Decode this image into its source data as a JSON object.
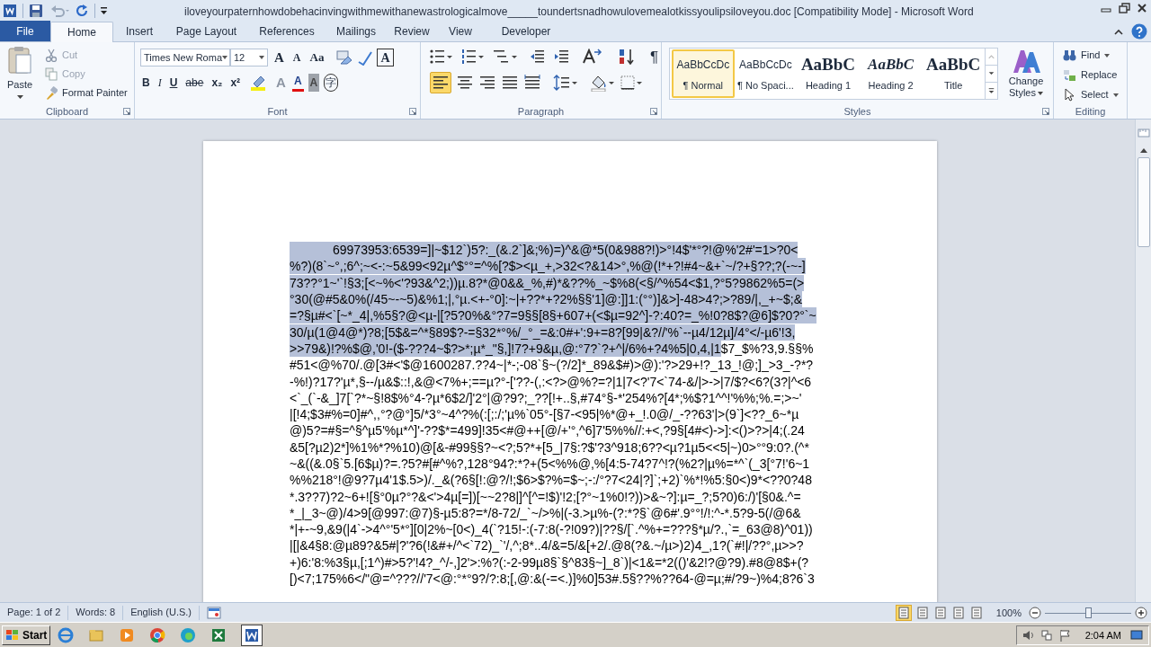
{
  "window": {
    "title": "iloveyourpaternhowdobehacinvingwithmewithanewastrologicalmove_____toundertsnadhowulovemealotkissyoulipsiloveyou.doc [Compatibility Mode]  -  Microsoft Word"
  },
  "tabs": [
    {
      "label": "File",
      "kind": "file",
      "selected": false
    },
    {
      "label": "Home",
      "kind": "tab",
      "selected": true
    },
    {
      "label": "Insert",
      "kind": "tab",
      "selected": false
    },
    {
      "label": "Page Layout",
      "kind": "tab",
      "selected": false
    },
    {
      "label": "References",
      "kind": "tab",
      "selected": false
    },
    {
      "label": "Mailings",
      "kind": "tab",
      "selected": false
    },
    {
      "label": "Review",
      "kind": "tab",
      "selected": false
    },
    {
      "label": "View",
      "kind": "tab",
      "selected": false
    },
    {
      "label": "Developer",
      "kind": "tab",
      "selected": false
    }
  ],
  "clipboard": {
    "label": "Clipboard",
    "paste": "Paste",
    "cut": {
      "label": "Cut",
      "disabled": true
    },
    "copy": {
      "label": "Copy",
      "disabled": true
    },
    "format_painter": {
      "label": "Format Painter",
      "disabled": false
    }
  },
  "font": {
    "label": "Font",
    "font_name": "Times New Roma",
    "font_size": "12",
    "row1": [
      {
        "label": "A",
        "kind": "grow"
      },
      {
        "label": "A",
        "kind": "shrink"
      },
      {
        "label": "Aa",
        "kind": "case"
      },
      {
        "label": "A",
        "kind": "boxed"
      }
    ],
    "row2": [
      {
        "label": "B",
        "kind": "bold"
      },
      {
        "label": "I",
        "kind": "italic"
      },
      {
        "label": "U",
        "kind": "underline"
      },
      {
        "label": "abe",
        "kind": "strike"
      },
      {
        "label": "x₂",
        "kind": "plain"
      },
      {
        "label": "x²",
        "kind": "plain"
      },
      {
        "label": "A",
        "kind": "effects"
      },
      {
        "label": "A",
        "kind": "color"
      },
      {
        "label": "A",
        "kind": "shade"
      },
      {
        "label": "字",
        "kind": "circle"
      }
    ]
  },
  "paragraph": {
    "label": "Paragraph",
    "show_marks": "¶",
    "align_left_on": true
  },
  "styles": {
    "label": "Styles",
    "items": [
      {
        "preview": "AaBbCcDc",
        "name": "¶ Normal",
        "kind": "plain",
        "selected": true
      },
      {
        "preview": "AaBbCcDc",
        "name": "¶ No Spaci...",
        "kind": "plain",
        "selected": false
      },
      {
        "preview": "AaBbC",
        "name": "Heading 1",
        "kind": "bold",
        "selected": false
      },
      {
        "preview": "AaBbC",
        "name": "Heading 2",
        "kind": "bold_italic",
        "selected": false
      },
      {
        "preview": "AaBbC",
        "name": "Title",
        "kind": "bold",
        "selected": false
      }
    ],
    "change_styles": [
      "Change",
      "Styles"
    ]
  },
  "editing": {
    "label": "Editing",
    "items": [
      {
        "label": "Find",
        "kind": "find"
      },
      {
        "label": "Replace",
        "kind": "replace"
      },
      {
        "label": "Select",
        "kind": "select"
      }
    ]
  },
  "document": {
    "lines": [
      {
        "segments": [
          {
            "text": "69973953:6539=]|~$12`)5?:_(&.2`]&;%)=)^&@*5(0&988?!)>°!4$'*°?!@%'2#'=1>?0<",
            "selected": true
          }
        ]
      },
      {
        "segments": [
          {
            "text": "%?)(8`~°,;6^;~<-:~5&99<92µ^$°°=^%[?$><µ_+,>32<?&14>°,%@(!*+?!#4~&+`~/?+§??;?(-~-]",
            "selected": true
          }
        ]
      },
      {
        "segments": [
          {
            "text": "73??°1~'`!§3;[<~%<'?93&^2;))µ.8?*@0&&_%,#)*&??%_~$%8(<§/^%54<$1,?°5?9862%5=(>",
            "selected": true
          }
        ]
      },
      {
        "segments": [
          {
            "text": "°30(@#5&0%(/45~-~5)&%1;|,°µ.<+-°0]:~|+??*+?2%§§'1]@:]]1:(°°)]&>]-48>4?;>?89/|,_+~$;&",
            "selected": true
          }
        ]
      },
      {
        "segments": [
          {
            "text": "=?§µ#<`[~*_4|,%5§?@<µ-|[?5?0%&°?7=9§§[8§+607+(<$µ=92^]-?:40?=_%!0?8$?@6]$?0?°`~",
            "selected": true
          }
        ]
      },
      {
        "segments": [
          {
            "text": "30/µ(1@4@*)?8;[5$&=^*§89$?-=§32*°%/_°_=&:0#+':9+=8?[99|&?//'%`--µ4/12µ]/4°</-µ6'!3,",
            "selected": true
          }
        ]
      },
      {
        "segments": [
          {
            "text": ">>79&)!?%$@,'0!-($-???4~$?>*;µ*_\"§,]!7?+9&µ,@:°7?`?+^|/6%+?4%5|0,4,|1",
            "selected": true
          },
          {
            "text": "$7_$%?3,9.§§%",
            "selected": false
          }
        ]
      },
      {
        "segments": [
          {
            "text": "#51<@%70/.@[3#<'$@1600287.??4~|*-;-08`§~(?/2]*_89&$#)>@):'?>29+!?_13_!@;]_>3_-?*?",
            "selected": false
          }
        ]
      },
      {
        "segments": [
          {
            "text": "-%!)?17?'µ*,§--/µ&$::!,&@<7%+;==µ?°-['??-(,:<?>@%?=?|1|7<?'7<`74-&/|>->|7/$?<6?(3?|^<6",
            "selected": false
          }
        ]
      },
      {
        "segments": [
          {
            "text": "<`_(`-&_]7[`?*~§!8$%°4-?µ*6$2/]'2°|@?9?;_??[!+..§,#74°§-*'254%?[4*;%$?1^^!'%%;%.=;>~'",
            "selected": false
          }
        ]
      },
      {
        "segments": [
          {
            "text": "|[!4;$3#%=0]#^,,°?@°]5/*3°~4^?%(:[;:/;'µ%`05°-[§7-<95|%*@+_!.0@/_-??63'|>(9`]<??_6~*µ",
            "selected": false
          }
        ]
      },
      {
        "segments": [
          {
            "text": "@)5?=#§=^§^µ5'%µ*^]'-??$*=499]!35<#@++[@/+'°,^6]7'5%%//:+<,?9§[4#<)->]:<()>?>|4;(.24",
            "selected": false
          }
        ]
      },
      {
        "segments": [
          {
            "text": "&5[?µ2)2*]%1%*?%10)@[&-#99§§?~<?;5?*+[5_|7§:?$'?3^918;6??<µ?1µ5<<5|~)0>°°9:0?.(^*",
            "selected": false
          }
        ]
      },
      {
        "segments": [
          {
            "text": "~&((&.0§`5.[6$µ)?=.?5?#[#^%?,128°94?:*?+(5<%%@,%[4:5-74?7^!?(%2?|µ%=*^`(_3[°7!'6~1",
            "selected": false
          }
        ]
      },
      {
        "segments": [
          {
            "text": "%%218°!@9?7µ4'1$.5>)/._&(?6§[!:@?/!;$6>$?%=$~;-:/°?7<24|?]`;+2)`%*!%5:§0<)9*<??0?48",
            "selected": false
          }
        ]
      },
      {
        "segments": [
          {
            "text": "*.3??7)?2~6+![§°0µ?°?&<'>4µ[=])[~~2?8|]^[^=!$)'!2;[?°~1%0!?))>&~?]:µ=_?;5?0)6:/)'[§0&.^=",
            "selected": false
          }
        ]
      },
      {
        "segments": [
          {
            "text": "*_|_3~@)/4>9[@997:@7)§-µ5:8?=*/8-72/_`~/>%|(-3.>µ%-(?:*?§`@6#'.9°°!/!:^-*.5?9-5(/@6&",
            "selected": false
          }
        ]
      },
      {
        "segments": [
          {
            "text": "*|+-~9,&9(|4`->4^°'5*°][0|2%~[0<)_4(`?15!-:(-7:8(-?!09?)|??§/[`.^%+=???§*µ/?.,`=_63@8)^01))",
            "selected": false
          }
        ]
      },
      {
        "segments": [
          {
            "text": "|[|&4§8:@µ89?&5#|?'?6(!&#+/^<`72)_`'/,^;8*..4/&=5/&[+2/.@8(?&.~/µ>)2)4_,1?(`#!|/??°,µ>>?",
            "selected": false
          }
        ]
      },
      {
        "segments": [
          {
            "text": "+)6:'8:%3§µ,[;1^)#>5?'!4?_^/-,]2'>:%?(:-2-99µ8§`§^83§~]_8`)|<1&=*2(()'&2!?@?9).#8@8$+(?",
            "selected": false
          }
        ]
      },
      {
        "segments": [
          {
            "text": "[)<7;175%6</\"@=^???//'7<@:°*°9?/?:8;[,@:&(-=<.)]%0]53#.5§??%??64-@=µ;#/?9~)%4;8?6`3",
            "selected": false
          }
        ]
      }
    ]
  },
  "status_bar": {
    "page": "Page: 1 of 2",
    "words": "Words: 8",
    "language": "English (U.S.)",
    "zoom": "100%",
    "zoom_slider": {
      "level": 0.5
    }
  },
  "taskbar": {
    "start": "Start",
    "time": "2:04 AM"
  }
}
